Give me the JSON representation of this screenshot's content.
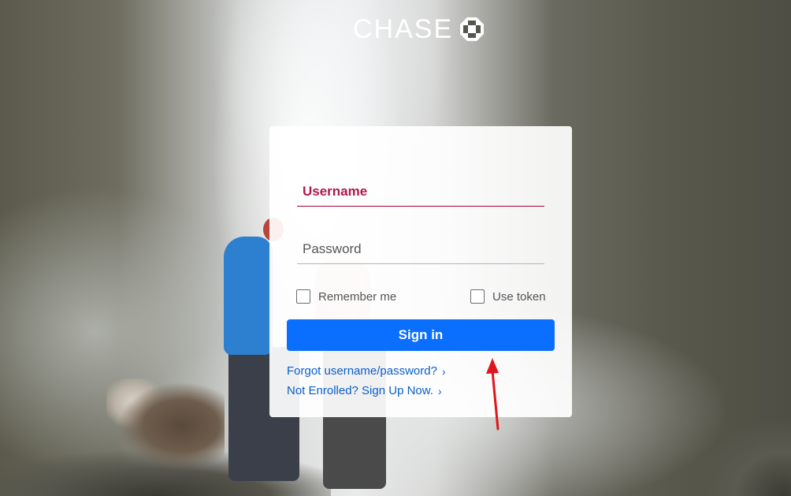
{
  "brand": {
    "name": "CHASE",
    "logo_icon": "chase-octagon-icon"
  },
  "login": {
    "username_label": "Username",
    "password_label": "Password",
    "remember_label": "Remember me",
    "token_label": "Use token",
    "signin_label": "Sign in",
    "forgot_link": "Forgot username/password?",
    "enroll_link": "Not Enrolled? Sign Up Now.",
    "chevron_icon": "chevron-right-icon"
  },
  "annotation": {
    "icon": "red-arrow-icon",
    "color": "#e0151b"
  },
  "colors": {
    "accent": "#0a6eff",
    "active_field": "#b01849",
    "link": "#0a5ec9"
  }
}
